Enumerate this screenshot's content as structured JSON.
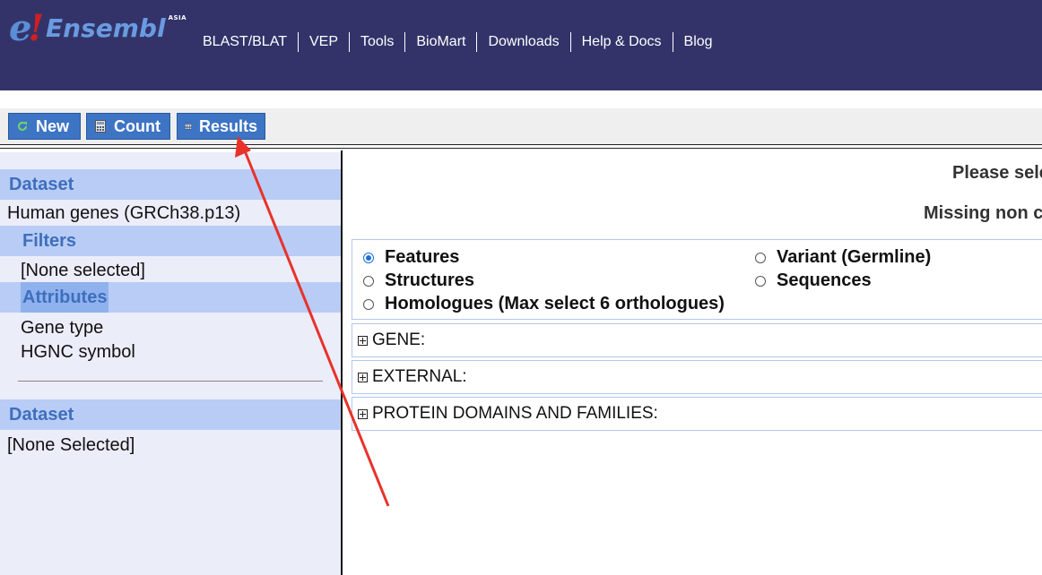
{
  "header": {
    "logo": {
      "e": "e",
      "bang": "!",
      "text": "Ensembl",
      "region": "ASIA"
    },
    "nav": [
      "BLAST/BLAT",
      "VEP",
      "Tools",
      "BioMart",
      "Downloads",
      "Help & Docs",
      "Blog"
    ]
  },
  "toolbar": {
    "new_label": "New",
    "count_label": "Count",
    "results_label": "Results"
  },
  "sidebar": {
    "dataset_heading": "Dataset",
    "dataset_value": "Human genes (GRCh38.p13)",
    "filters_heading": "Filters",
    "filters_value": "[None selected]",
    "attributes_heading": "Attributes",
    "attributes": [
      "Gene type",
      "HGNC symbol"
    ],
    "dataset2_heading": "Dataset",
    "dataset2_value": "[None Selected]"
  },
  "main": {
    "prompt_line1": "Please sele",
    "prompt_line2": "Missing non c",
    "attribute_pages": [
      {
        "label": "Features",
        "checked": true
      },
      {
        "label": "Variant (Germline)",
        "checked": false
      },
      {
        "label": "Structures",
        "checked": false
      },
      {
        "label": "Sequences",
        "checked": false
      },
      {
        "label": "Homologues (Max select 6 orthologues)",
        "checked": false
      }
    ],
    "sections": [
      "GENE:",
      "EXTERNAL:",
      "PROTEIN DOMAINS AND FAMILIES:"
    ]
  },
  "colors": {
    "header_bg": "#33336a",
    "button_bg": "#3d74c4",
    "sidebar_heading_bg": "#b8ccf6",
    "annotation_arrow": "#e8322a"
  }
}
